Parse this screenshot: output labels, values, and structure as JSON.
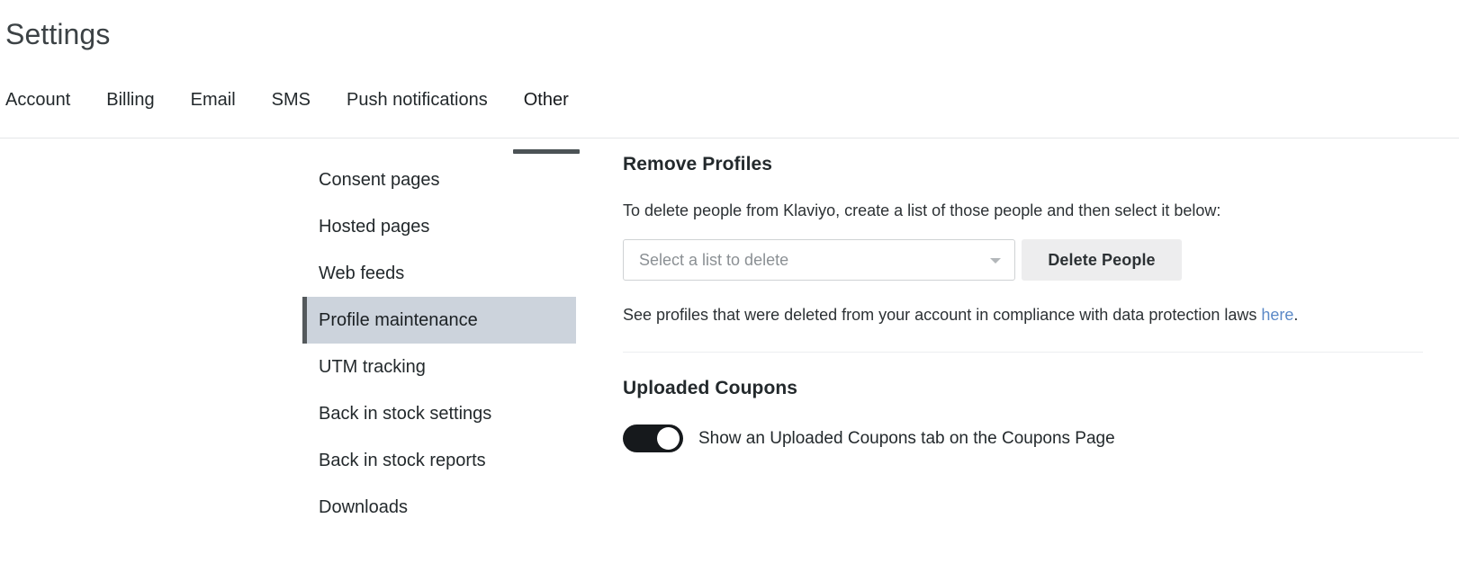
{
  "header": {
    "title": "Settings"
  },
  "tabs": [
    {
      "label": "Account",
      "active": false
    },
    {
      "label": "Billing",
      "active": false
    },
    {
      "label": "Email",
      "active": false
    },
    {
      "label": "SMS",
      "active": false
    },
    {
      "label": "Push notifications",
      "active": false
    },
    {
      "label": "Other",
      "active": true
    }
  ],
  "side_nav": {
    "items": [
      {
        "label": "Consent pages",
        "selected": false
      },
      {
        "label": "Hosted pages",
        "selected": false
      },
      {
        "label": "Web feeds",
        "selected": false
      },
      {
        "label": "Profile maintenance",
        "selected": true
      },
      {
        "label": "UTM tracking",
        "selected": false
      },
      {
        "label": "Back in stock settings",
        "selected": false
      },
      {
        "label": "Back in stock reports",
        "selected": false
      },
      {
        "label": "Downloads",
        "selected": false
      }
    ]
  },
  "remove_profiles": {
    "heading": "Remove Profiles",
    "description": "To delete people from Klaviyo, create a list of those people and then select it below:",
    "select_placeholder": "Select a list to delete",
    "delete_button": "Delete People",
    "note_text": "See profiles that were deleted from your account in compliance with data protection laws ",
    "note_link": "here",
    "note_suffix": "."
  },
  "uploaded_coupons": {
    "heading": "Uploaded Coupons",
    "toggle_label": "Show an Uploaded Coupons tab on the Coupons Page",
    "toggle_on": true
  },
  "colors": {
    "link": "#5b89c7",
    "selected_nav_bg": "#ccd3dc",
    "selected_nav_bar": "#54595c",
    "active_tab_underline": "#4c5356",
    "toggle_on_bg": "#16191c",
    "button_bg": "#ededee"
  }
}
